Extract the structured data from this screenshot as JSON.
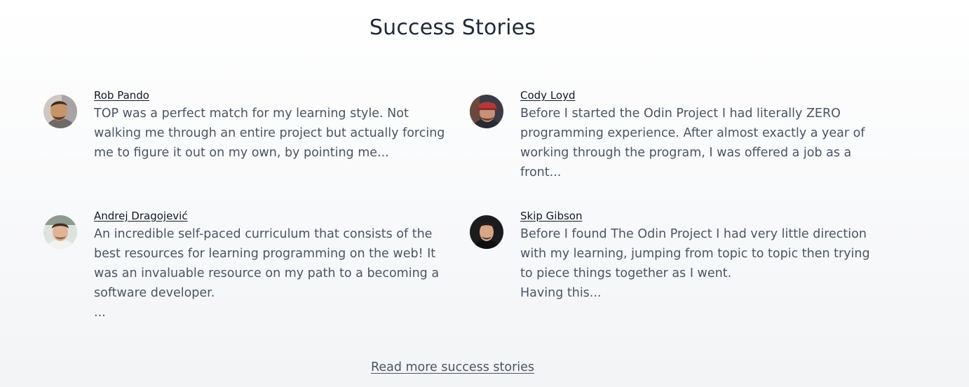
{
  "section": {
    "title": "Success Stories"
  },
  "stories": [
    {
      "name": "Rob Pando",
      "text": "TOP was a perfect match for my learning style. Not walking me through an entire project but actually forcing me to figure it out on my own, by pointing me..."
    },
    {
      "name": "Cody Loyd",
      "text": "Before I started the Odin Project I had literally ZERO programming experience. After almost exactly a year of working through the program, I was offered a job as a front..."
    },
    {
      "name": "Andrej Dragojević",
      "text": "An incredible self-paced curriculum that consists of the best resources for learning programming on the web! It was an invaluable resource on my path to a becoming a software developer.\n..."
    },
    {
      "name": "Skip Gibson",
      "text": "Before I found The Odin Project I had very little direction with my learning, jumping from topic to topic then trying to piece things together as I went.\nHaving this..."
    }
  ],
  "footer": {
    "read_more_label": "Read more success stories"
  }
}
